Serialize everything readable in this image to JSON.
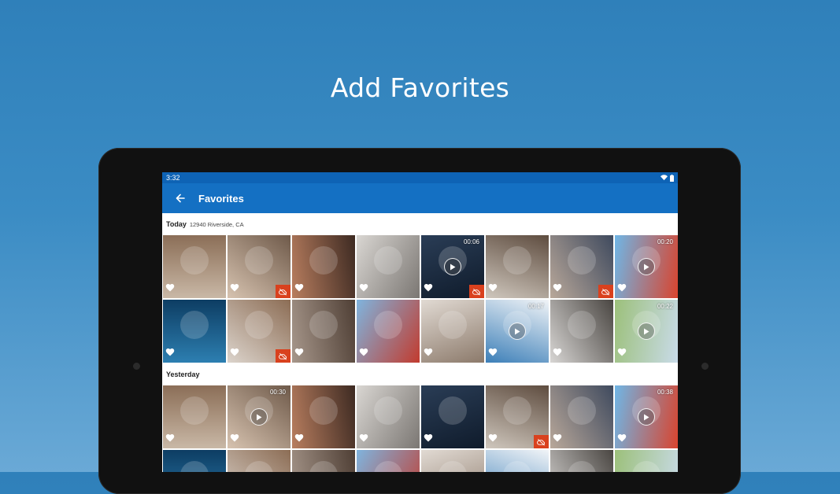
{
  "headline": "Add Favorites",
  "status_bar": {
    "time": "3:32",
    "icons": [
      "wifi-icon",
      "battery-icon"
    ]
  },
  "app_bar": {
    "title": "Favorites",
    "back_icon": "arrow-back-icon"
  },
  "colors": {
    "accent": "#1470c3",
    "status": "#0e63b5",
    "cloud_badge": "#d9411e"
  },
  "sections": [
    {
      "title": "Today",
      "subtitle": "12940 Riverside, CA",
      "rows": [
        [
          {
            "subject": "woman-with-laptop",
            "duration": "",
            "cloud": false
          },
          {
            "subject": "friends-selfie",
            "duration": "",
            "cloud": true
          },
          {
            "subject": "couple-portrait",
            "duration": "",
            "cloud": false
          },
          {
            "subject": "woman-on-laptop",
            "duration": "",
            "cloud": false
          },
          {
            "subject": "server-room",
            "duration": "00:06",
            "cloud": true
          },
          {
            "subject": "family-tablet",
            "duration": "",
            "cloud": false
          },
          {
            "subject": "team-meeting",
            "duration": "",
            "cloud": true
          },
          {
            "subject": "skydivers",
            "duration": "00:20",
            "cloud": false
          }
        ],
        [
          {
            "subject": "manta-rays",
            "duration": "",
            "cloud": false
          },
          {
            "subject": "woman-glasses",
            "duration": "",
            "cloud": true
          },
          {
            "subject": "office-woman",
            "duration": "",
            "cloud": false
          },
          {
            "subject": "hot-air-balloons",
            "duration": "",
            "cloud": false
          },
          {
            "subject": "woman-phone",
            "duration": "",
            "cloud": false
          },
          {
            "subject": "jet-ski",
            "duration": "00:17",
            "cloud": false
          },
          {
            "subject": "woman-desk",
            "duration": "",
            "cloud": false
          },
          {
            "subject": "mountain-bikers",
            "duration": "00:22",
            "cloud": false
          }
        ]
      ]
    },
    {
      "title": "Yesterday",
      "subtitle": "",
      "rows": [
        [
          {
            "subject": "bearded-man",
            "duration": "",
            "cloud": false
          },
          {
            "subject": "rafting",
            "duration": "00:30",
            "cloud": false
          },
          {
            "subject": "woman-laptop-red",
            "duration": "",
            "cloud": false
          },
          {
            "subject": "friends-group",
            "duration": "",
            "cloud": false
          },
          {
            "subject": "woman-couch",
            "duration": "",
            "cloud": false
          },
          {
            "subject": "woman-lamp-laptop",
            "duration": "",
            "cloud": true
          },
          {
            "subject": "woman-laptop-smile",
            "duration": "",
            "cloud": false
          },
          {
            "subject": "penguin-animation",
            "duration": "00:38",
            "cloud": false
          }
        ],
        [
          {
            "subject": "woman-portrait",
            "duration": "",
            "cloud": false
          },
          {
            "subject": "woman-smile",
            "duration": "",
            "cloud": false
          },
          {
            "subject": "tech-dark",
            "duration": "",
            "cloud": false
          },
          {
            "subject": "woman-phone-2",
            "duration": "",
            "cloud": false
          },
          {
            "subject": "woman-bright",
            "duration": "",
            "cloud": false
          },
          {
            "subject": "office-group",
            "duration": "",
            "cloud": false
          },
          {
            "subject": "woman-hair",
            "duration": "",
            "cloud": false
          },
          {
            "subject": "office-light",
            "duration": "",
            "cloud": false
          }
        ]
      ]
    }
  ]
}
